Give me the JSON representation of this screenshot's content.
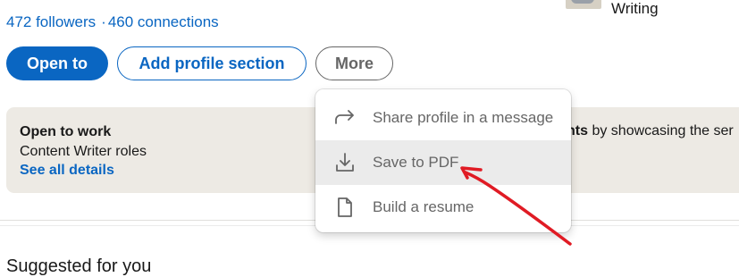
{
  "profile": {
    "followers": "472 followers",
    "connections": "460 connections",
    "separator": "·"
  },
  "side_card": {
    "label": "Writing"
  },
  "actions": {
    "open_to": "Open to",
    "add_section": "Add profile section",
    "more": "More"
  },
  "open_to_work": {
    "title": "Open to work",
    "subtitle": "Content Writer roles",
    "link": "See all details",
    "right_bold": "nts",
    "right_text": " by showcasing the ser"
  },
  "suggested": {
    "title": "Suggested for you"
  },
  "menu": {
    "items": [
      {
        "label": "Share profile in a message",
        "icon": "share-arrow-icon"
      },
      {
        "label": "Save to PDF",
        "icon": "download-icon"
      },
      {
        "label": "Build a resume",
        "icon": "document-icon"
      }
    ],
    "highlighted_index": 1
  },
  "colors": {
    "primary": "#0a66c2",
    "card_bg": "#edeae4",
    "annotation": "#e01b24"
  }
}
